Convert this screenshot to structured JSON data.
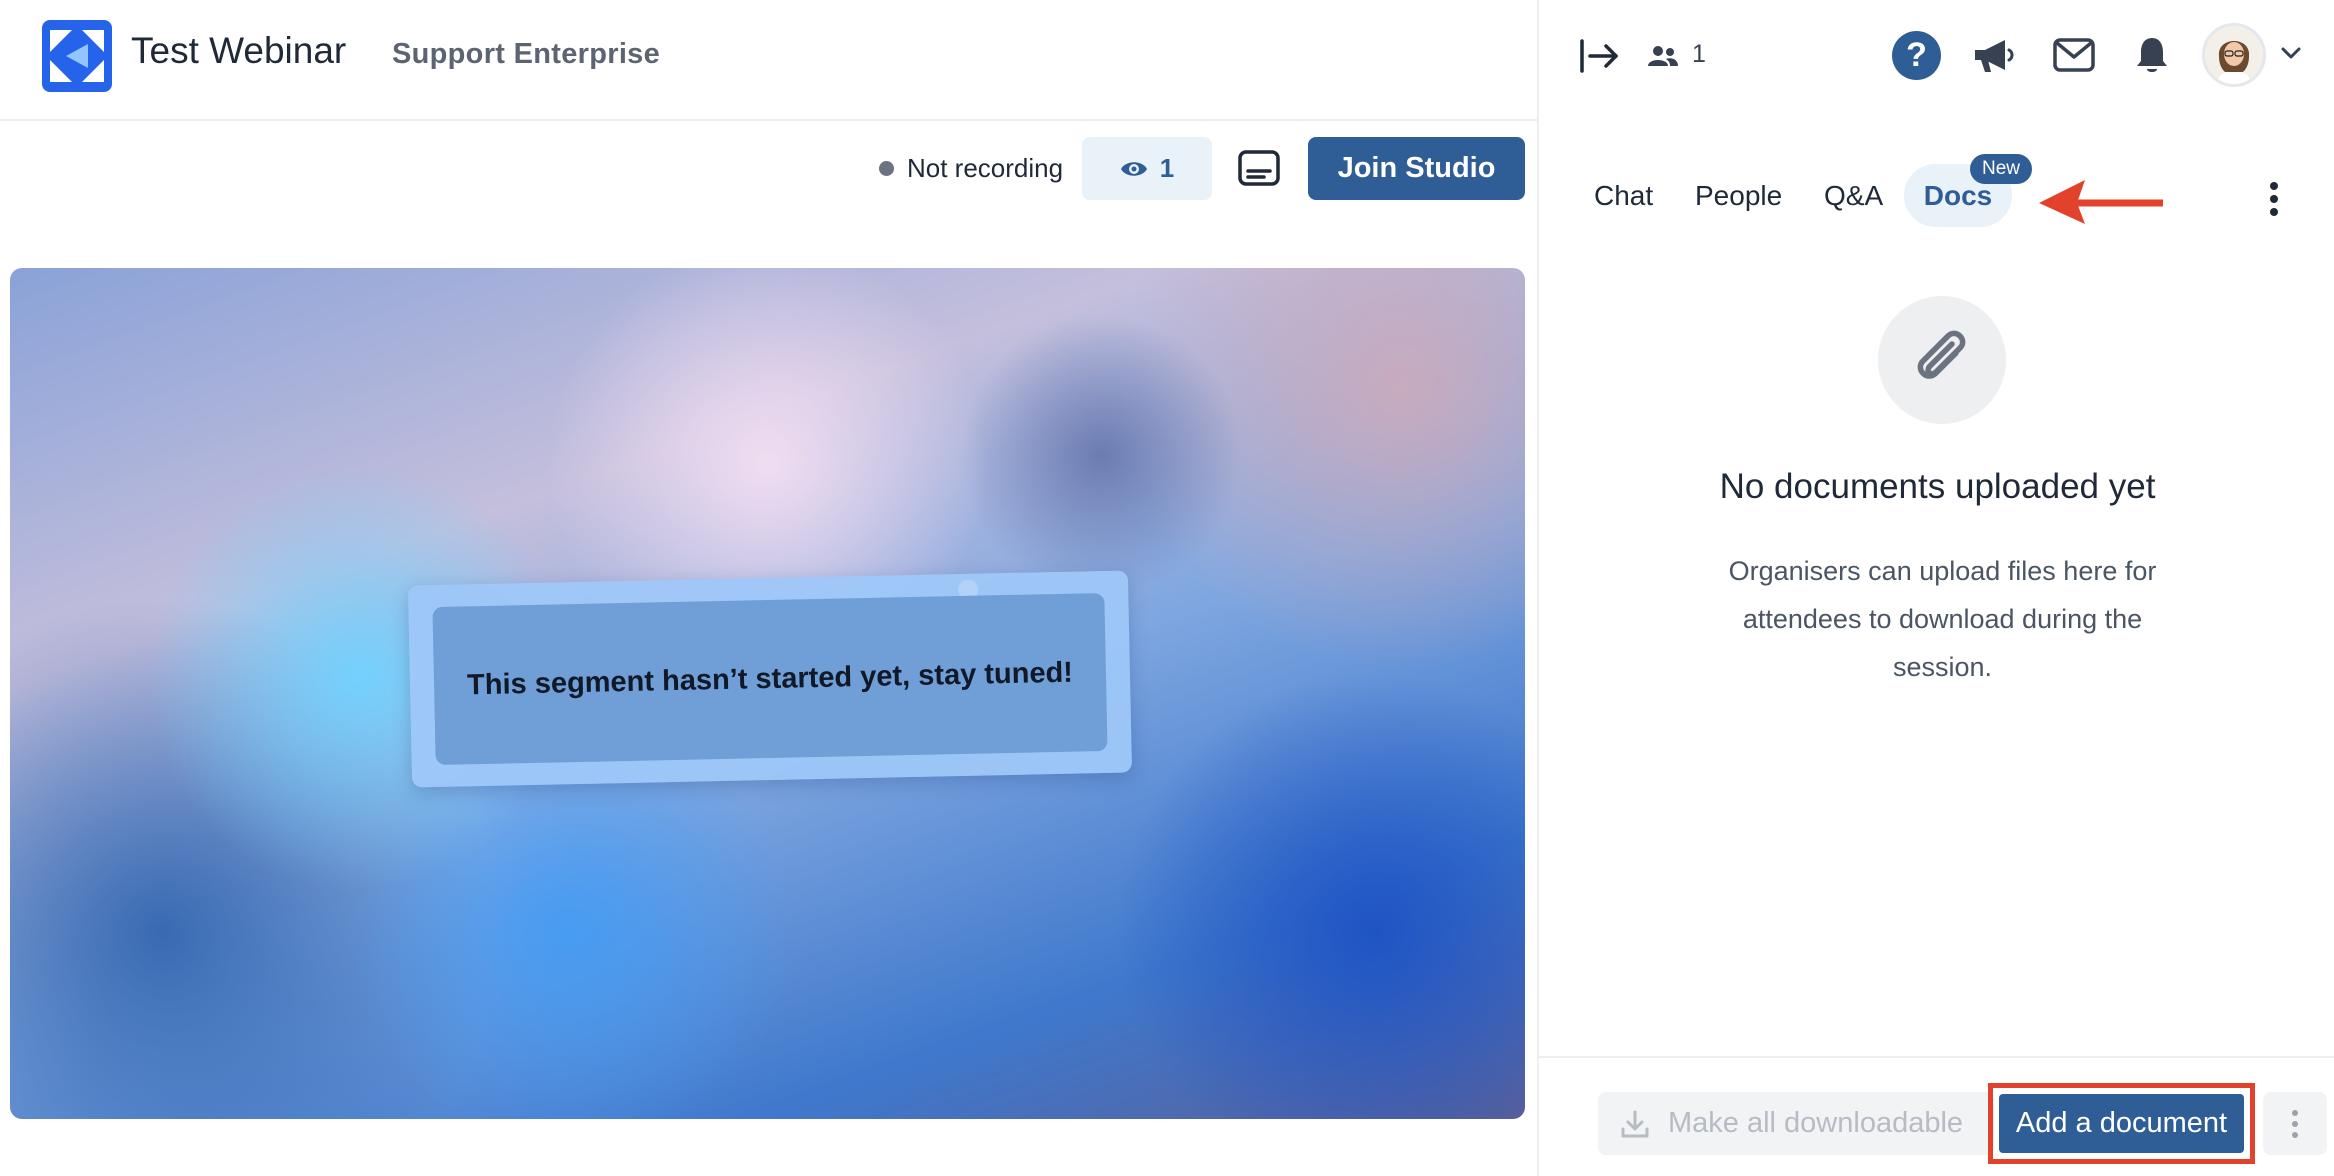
{
  "header": {
    "event_title": "Test Webinar",
    "org_name": "Support Enterprise"
  },
  "toolbar": {
    "recording_status": "Not recording",
    "viewer_count": "1",
    "join_label": "Join Studio"
  },
  "stage": {
    "notice": "This segment hasn’t started yet, stay tuned!"
  },
  "panel_header": {
    "people_count": "1",
    "help_symbol": "?"
  },
  "tabs": [
    {
      "label": "Chat"
    },
    {
      "label": "People"
    },
    {
      "label": "Q&A"
    },
    {
      "label": "Docs",
      "active": true,
      "badge": "New"
    }
  ],
  "docs": {
    "empty_title": "No documents uploaded yet",
    "empty_desc": "Organisers can upload files here for attendees to download during the session."
  },
  "footer": {
    "make_downloadable_label": "Make all downloadable",
    "add_document_label": "Add a document"
  },
  "icons": {
    "logo": "brand-logo-icon",
    "eye": "eye-icon",
    "captions": "captions-icon",
    "collapse": "exit-arrow-icon",
    "people": "people-icon",
    "help": "help-icon",
    "megaphone": "megaphone-icon",
    "mail": "mail-icon",
    "bell": "bell-icon",
    "paperclip": "paperclip-icon",
    "download": "download-icon",
    "kebab": "kebab-icon"
  },
  "colors": {
    "primary": "#2f5d96",
    "highlight": "#e2422b",
    "active_tab_bg": "#e9f1f9"
  }
}
